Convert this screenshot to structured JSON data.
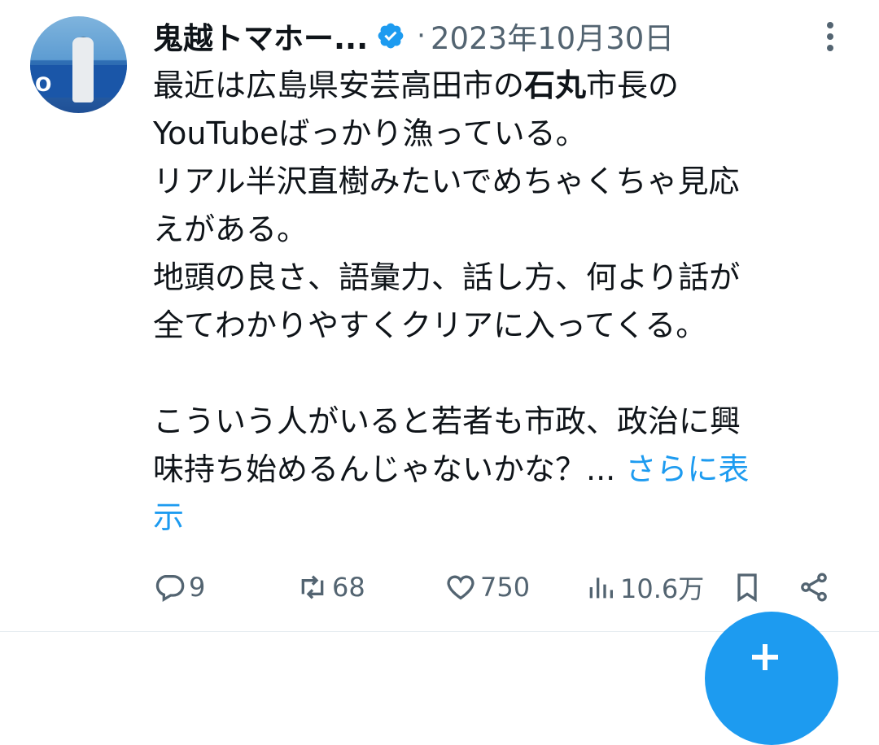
{
  "tweet": {
    "author_name": "鬼越トマホー...",
    "separator": "·",
    "date": "2023年10月30日",
    "lines": [
      {
        "pre": "最近は広島県安芸高田市の",
        "bold": "石丸",
        "post": "市長の"
      },
      {
        "pre": "YouTubeばっかり漁っている。"
      },
      {
        "pre": "リアル半沢直樹みたいでめちゃくちゃ見応"
      },
      {
        "pre": "えがある。"
      },
      {
        "pre": "地頭の良さ、語彙力、話し方、何より話が"
      },
      {
        "pre": "全てわかりやすくクリアに入ってくる。"
      },
      {
        "pre": ""
      },
      {
        "pre": "こういう人がいると若者も市政、政治に興"
      },
      {
        "pre": "味持ち始めるんじゃないかな？... ",
        "link": "さらに表"
      },
      {
        "link": "示"
      }
    ],
    "avatar_text": "O"
  },
  "actions": {
    "replies": "9",
    "retweets": "68",
    "likes": "750",
    "views": "10.6万"
  },
  "icons": {
    "verified": "verified-badge-icon",
    "more": "more-vertical-icon",
    "reply": "reply-icon",
    "retweet": "retweet-icon",
    "like": "heart-icon",
    "views": "views-chart-icon",
    "bookmark": "bookmark-icon",
    "share": "share-icon",
    "compose": "compose-plus-icon"
  },
  "colors": {
    "accent": "#1d9bf0",
    "text": "#0f1419",
    "muted": "#536471"
  }
}
